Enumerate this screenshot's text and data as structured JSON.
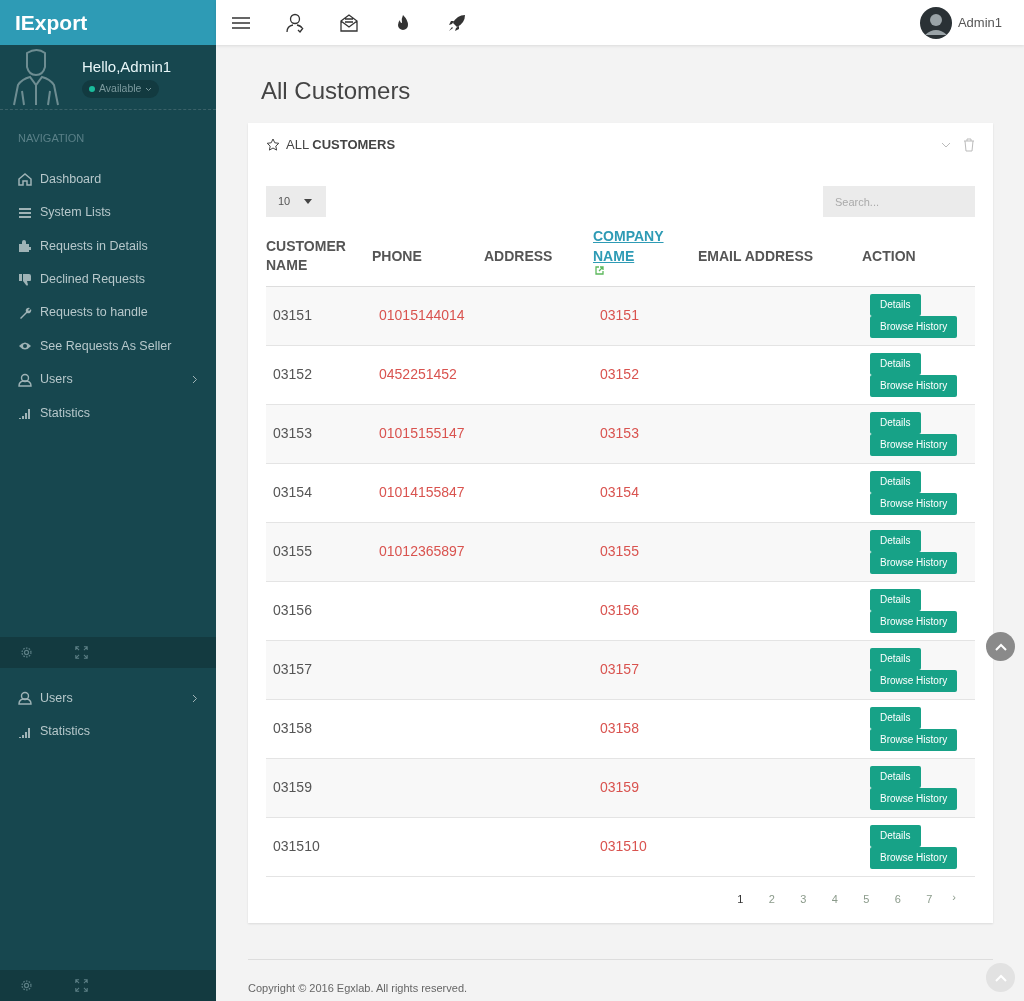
{
  "brand": "IExport",
  "profile": {
    "greeting": "Hello,Admin1",
    "status": "Available"
  },
  "sidebar": {
    "heading": "NAVIGATION",
    "items": [
      {
        "label": "Dashboard",
        "kind": "home",
        "has_submenu": false
      },
      {
        "label": "System Lists",
        "kind": "list",
        "has_submenu": false
      },
      {
        "label": "Requests in Details",
        "kind": "puzzle",
        "has_submenu": false
      },
      {
        "label": "Declined Requests",
        "kind": "thumb",
        "has_submenu": false
      },
      {
        "label": "Requests to handle",
        "kind": "wrench",
        "has_submenu": false
      },
      {
        "label": "See Requests As Seller",
        "kind": "eye",
        "has_submenu": false
      },
      {
        "label": "Users",
        "kind": "user",
        "has_submenu": true
      },
      {
        "label": "Statistics",
        "kind": "signal",
        "has_submenu": false
      }
    ],
    "overlay_items": [
      {
        "label": "Users",
        "kind": "user",
        "has_submenu": true
      },
      {
        "label": "Statistics",
        "kind": "signal",
        "has_submenu": false
      }
    ]
  },
  "topbar": {
    "user_name": "Admin1"
  },
  "page_title": "All Customers",
  "card": {
    "title": "ALL **CUSTOMERS**"
  },
  "table_controls": {
    "page_size": "10",
    "search_placeholder": "Search..."
  },
  "table": {
    "columns": [
      {
        "label": "CUSTOMER NAME",
        "sorted": false
      },
      {
        "label": "PHONE",
        "sorted": false
      },
      {
        "label": "ADDRESS",
        "sorted": false
      },
      {
        "label": "COMPANY NAME",
        "sorted": true
      },
      {
        "label": "EMAIL ADDRESS",
        "sorted": false
      },
      {
        "label": "ACTION",
        "sorted": false
      }
    ],
    "rows": [
      {
        "customer_name": "03151",
        "phone": "01015144014",
        "company_name": "03151",
        "actions": [
          "Details",
          "Browse History"
        ]
      },
      {
        "customer_name": "03152",
        "phone": "0452251452",
        "company_name": "03152",
        "actions": [
          "Details",
          "Browse History"
        ]
      },
      {
        "customer_name": "03153",
        "phone": "01015155147",
        "company_name": "03153",
        "actions": [
          "Details",
          "Browse History"
        ]
      },
      {
        "customer_name": "03154",
        "phone": "01014155847",
        "company_name": "03154",
        "actions": [
          "Details",
          "Browse History"
        ]
      },
      {
        "customer_name": "03155",
        "phone": "01012365897",
        "company_name": "03155",
        "actions": [
          "Details",
          "Browse History"
        ]
      },
      {
        "customer_name": "03156",
        "company_name": "03156",
        "actions": [
          "Details",
          "Browse History"
        ]
      },
      {
        "customer_name": "03157",
        "company_name": "03157",
        "actions": [
          "Details",
          "Browse History"
        ]
      },
      {
        "customer_name": "03158",
        "company_name": "03158",
        "actions": [
          "Details",
          "Browse History"
        ]
      },
      {
        "customer_name": "03159",
        "company_name": "03159",
        "actions": [
          "Details",
          "Browse History"
        ]
      },
      {
        "customer_name": "031510",
        "company_name": "031510",
        "actions": [
          "Details",
          "Browse History"
        ]
      }
    ]
  },
  "pagination": {
    "pages": [
      {
        "label": "1",
        "selected": true
      },
      {
        "label": "2",
        "selected": false
      },
      {
        "label": "3",
        "selected": false
      },
      {
        "label": "4",
        "selected": false
      },
      {
        "label": "5",
        "selected": false
      },
      {
        "label": "6",
        "selected": false
      },
      {
        "label": "7",
        "selected": false
      }
    ],
    "next": "›"
  },
  "footer": "Copyright © 2016 Egxlab. All rights reserved."
}
